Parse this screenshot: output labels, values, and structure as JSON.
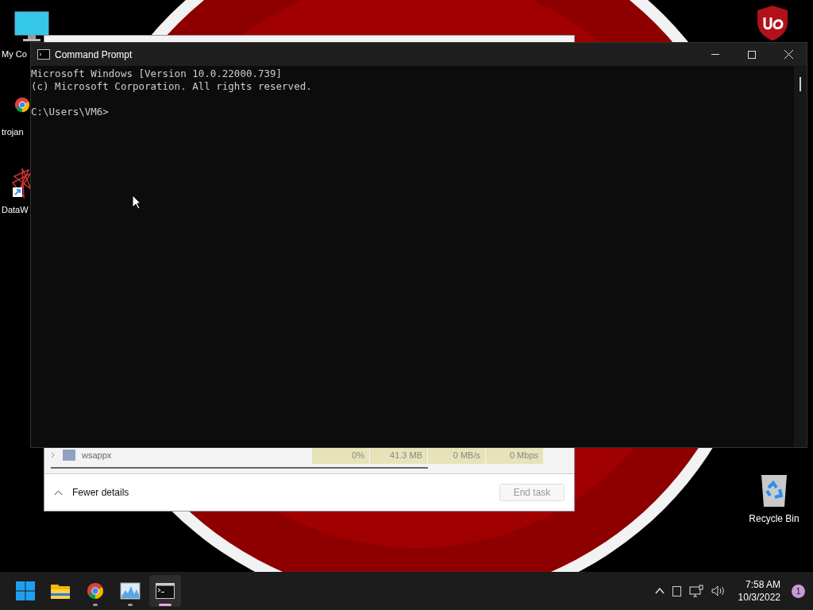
{
  "desktop_icons": [
    {
      "kind": "computer",
      "label": "My Co"
    },
    {
      "kind": "chrome",
      "label": "trojan"
    },
    {
      "kind": "shortcut",
      "label": "DataW"
    }
  ],
  "recycle_bin": {
    "label": "Recycle Bin"
  },
  "task_manager": {
    "row": {
      "name": "wsappx",
      "cells": [
        "0%",
        "41.3 MB",
        "0 MB/s",
        "0 Mbps"
      ]
    },
    "fewer_details": "Fewer details",
    "end_task": {
      "label": "End task",
      "disabled": true
    }
  },
  "console": {
    "title": "Command Prompt",
    "lines": [
      "Microsoft Windows [Version 10.0.22000.739]",
      "(c) Microsoft Corporation. All rights reserved."
    ],
    "prompt": "C:\\Users\\VM6>"
  },
  "taskbar": {
    "apps": [
      {
        "kind": "start",
        "running": false,
        "selected": false
      },
      {
        "kind": "explorer",
        "running": false,
        "selected": false
      },
      {
        "kind": "chrome",
        "running": true,
        "selected": false
      },
      {
        "kind": "monitor",
        "running": true,
        "selected": false
      },
      {
        "kind": "terminal",
        "running": true,
        "selected": true
      }
    ],
    "time": "7:58 AM",
    "date": "10/3/2022",
    "notifications": "1"
  }
}
